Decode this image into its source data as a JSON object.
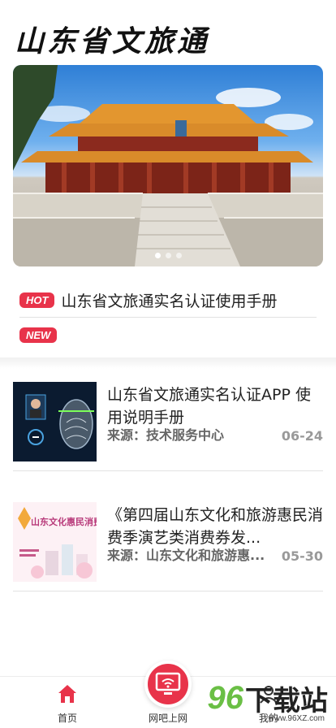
{
  "app": {
    "title": "山东省文旅通"
  },
  "banner": {
    "image": "confucius-temple-photo",
    "slide_count": 3,
    "active_slide": 1
  },
  "notices": [
    {
      "tag": "HOT",
      "text": "山东省文旅通实名认证使用手册"
    },
    {
      "tag": "NEW",
      "text": ""
    }
  ],
  "news": [
    {
      "title": "山东省文旅通实名认证APP 使用说明手册",
      "source": "来源：技术服务中心",
      "date": "06-24",
      "thumb": "face-scan-thumbnail"
    },
    {
      "title": "《第四届山东文化和旅游惠民消费季演艺类消费券发...",
      "source": "来源：山东文化和旅游惠...",
      "date": "05-30",
      "thumb": "consumption-season-poster-thumbnail",
      "thumb_text": "山东文化惠民消费季"
    }
  ],
  "tabbar": {
    "home": "首页",
    "net": "网吧上网",
    "mine": "我的"
  },
  "watermark": {
    "number": "96",
    "text": "下载站",
    "url": "www.96XZ.com"
  },
  "colors": {
    "accent": "#e8334a",
    "text": "#222222",
    "muted": "#999999"
  }
}
